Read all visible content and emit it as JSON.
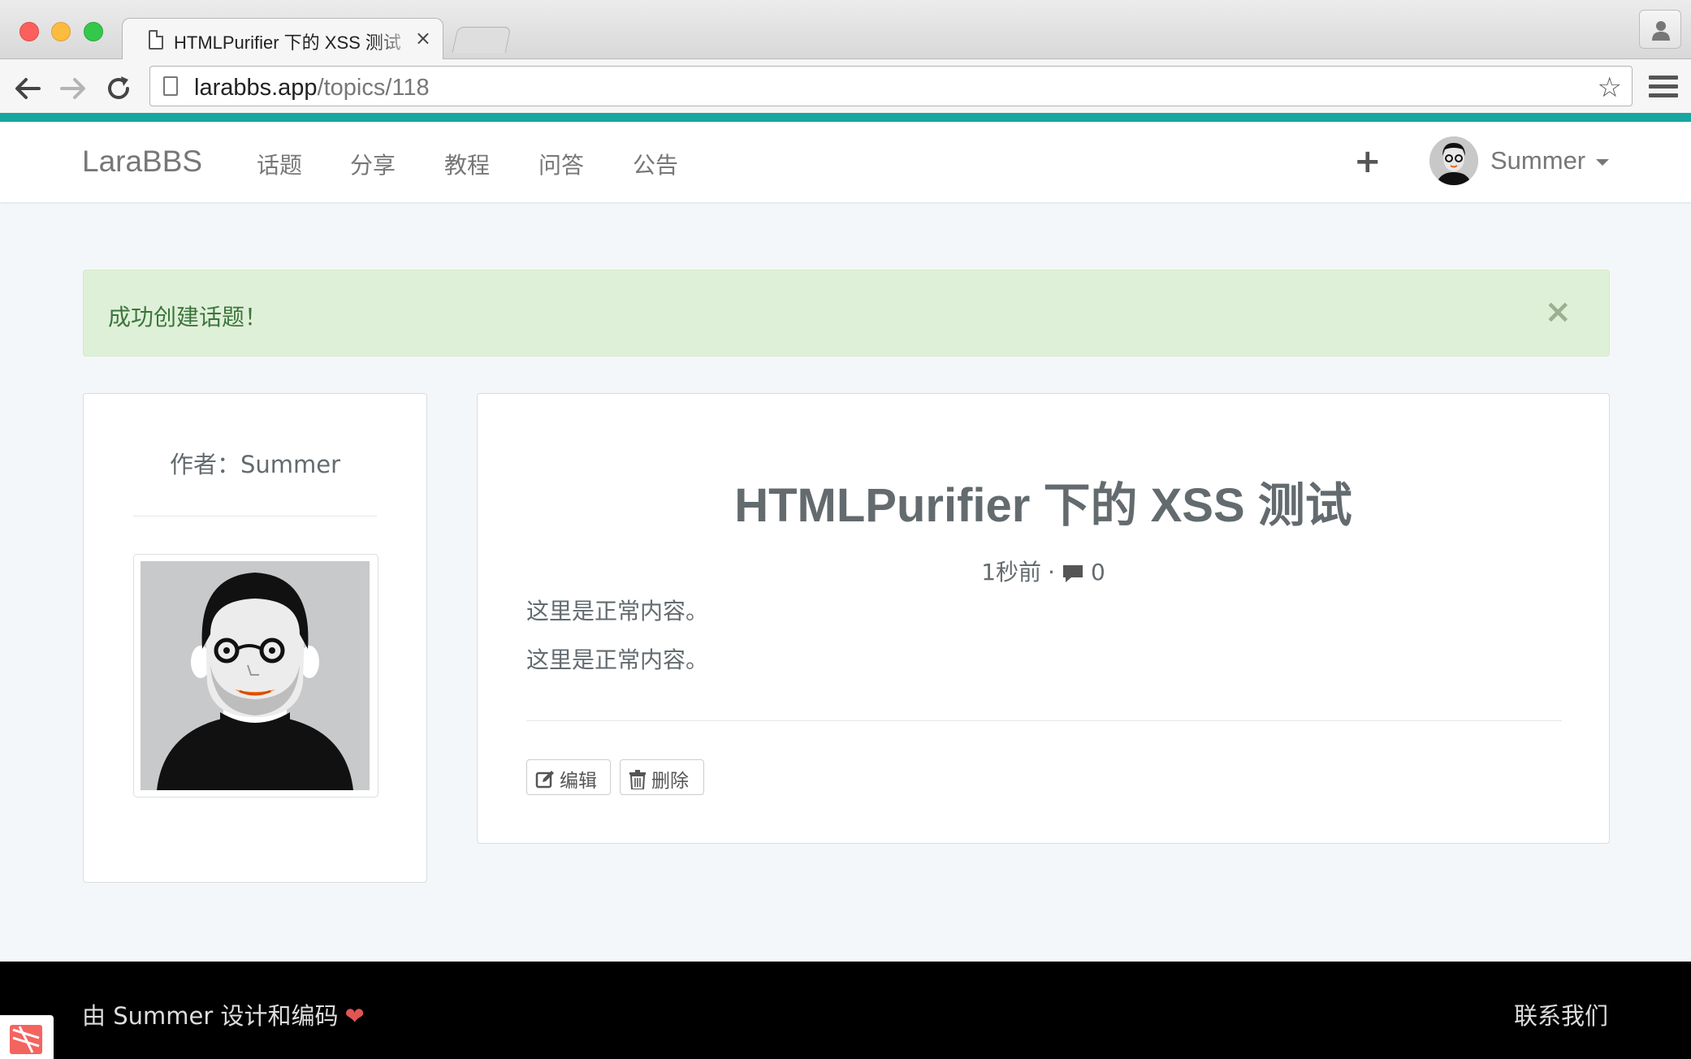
{
  "browser": {
    "tab_title": "HTMLPurifier 下的 XSS 测试",
    "tab_close": "×",
    "url_host": "larabbs.app",
    "url_path": "/topics/118"
  },
  "navbar": {
    "brand": "LaraBBS",
    "links": [
      "话题",
      "分享",
      "教程",
      "问答",
      "公告"
    ],
    "plus": "+",
    "user_name": "Summer"
  },
  "alert": {
    "message": "成功创建话题！",
    "close": "×"
  },
  "author": {
    "label": "作者：Summer"
  },
  "topic": {
    "title": "HTMLPurifier 下的 XSS 测试",
    "time_ago": "1秒前",
    "separator": "·",
    "reply_count": "0",
    "paragraphs": [
      "这里是正常内容。",
      "这里是正常内容。"
    ],
    "edit_label": "编辑",
    "delete_label": "删除"
  },
  "footer": {
    "credit": "由 Summer 设计和编码",
    "heart": "❤",
    "contact": "联系我们"
  },
  "colors": {
    "accent_border": "#17a7a0",
    "alert_bg": "#dff0d8",
    "alert_text": "#3c763d",
    "footer_bg": "#000000",
    "heart": "#e25555"
  }
}
